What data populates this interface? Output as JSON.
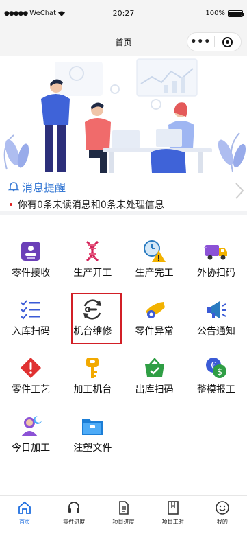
{
  "status_bar": {
    "carrier": "WeChat",
    "time": "20:27",
    "battery": "100%"
  },
  "nav": {
    "title": "首页",
    "more_label": "•••"
  },
  "notice": {
    "title": "消息提醒",
    "message": "你有0条未读消息和0条未处理信息"
  },
  "menu": {
    "items": [
      {
        "label": "零件接收",
        "icon": "receive-badge-icon"
      },
      {
        "label": "生产开工",
        "icon": "dna-icon"
      },
      {
        "label": "生产完工",
        "icon": "clock-warning-icon"
      },
      {
        "label": "外协扫码",
        "icon": "delivery-truck-icon"
      },
      {
        "label": "入库扫码",
        "icon": "checklist-icon"
      },
      {
        "label": "机台维修",
        "icon": "wrench-cycle-icon"
      },
      {
        "label": "零件异常",
        "icon": "gear-hand-icon"
      },
      {
        "label": "公告通知",
        "icon": "megaphone-icon"
      },
      {
        "label": "零件工艺",
        "icon": "alert-diamond-icon"
      },
      {
        "label": "加工机台",
        "icon": "key-icon"
      },
      {
        "label": "出库扫码",
        "icon": "basket-check-icon"
      },
      {
        "label": "整模报工",
        "icon": "coins-icon"
      },
      {
        "label": "今日加工",
        "icon": "user-moon-icon"
      },
      {
        "label": "注塑文件",
        "icon": "folder-icon"
      }
    ]
  },
  "tabbar": {
    "tabs": [
      {
        "label": "首页",
        "icon": "home-icon"
      },
      {
        "label": "零件进度",
        "icon": "headset-icon"
      },
      {
        "label": "项目进度",
        "icon": "document-icon"
      },
      {
        "label": "项目工时",
        "icon": "bookmark-icon"
      },
      {
        "label": "我的",
        "icon": "smile-icon"
      }
    ]
  },
  "colors": {
    "accent": "#1f6fe0",
    "notice_title": "#3a7bd5",
    "highlight": "#d21f26"
  }
}
